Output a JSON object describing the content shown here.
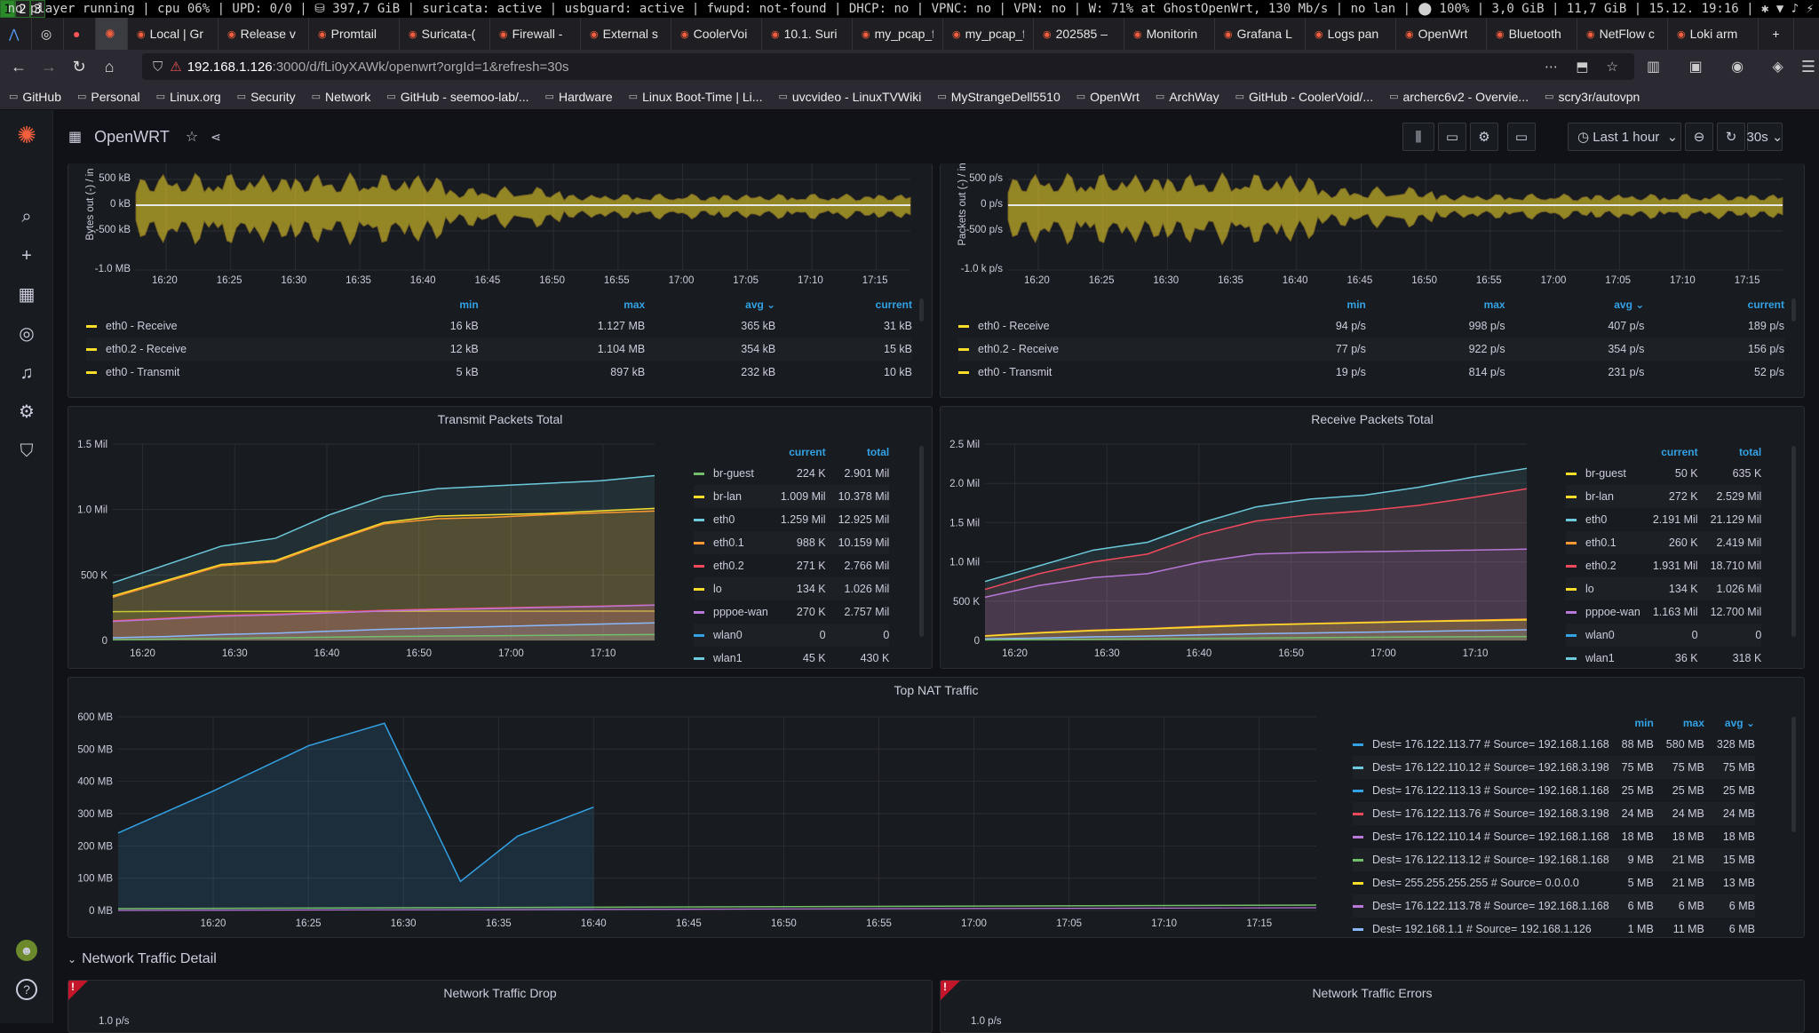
{
  "statusbar": {
    "workspaces": [
      "1",
      "2",
      "3"
    ],
    "text": "no player running | cpu  06% | UPD: 0/0 | ⛁ 397,7 GiB | suricata: active | usbguard: active | fwupd: not-found | DHCP: no | VPNC: no | VPN: no | W:  71% at GhostOpenWrt, 130 Mb/s | no lan | ⬤ 100% | 3,0 GiB | 11,7 GiB | 15.12. 19:16 | ✱ ▼ ♪ ⚡"
  },
  "tabs": [
    "Local | Gr",
    "Release v",
    "Promtail",
    "Suricata-(",
    "Firewall -",
    "External s",
    "CoolerVoi",
    "10.1. Suri",
    "my_pcap_file",
    "my_pcap_file",
    "202585 –",
    "Monitorin",
    "Grafana L",
    "Logs pan",
    "OpenWrt",
    "Bluetooth",
    "NetFlow c",
    "Loki arm"
  ],
  "url": {
    "host": "192.168.1.126",
    "path": ":3000/d/fLi0yXAWk/openwrt?orgId=1&refresh=30s"
  },
  "bookmarks": [
    "GitHub",
    "Personal",
    "Linux.org",
    "Security",
    "Network",
    "GitHub - seemoo-lab/...",
    "Hardware",
    "Linux Boot-Time | Li...",
    "uvcvideo - LinuxTVWiki",
    "MyStrangeDell5510",
    "OpenWrt",
    "ArchWay",
    "GitHub - CoolerVoid/...",
    "archerc6v2 - Overvie...",
    "scry3r/autovpn"
  ],
  "dashboard": {
    "title": "OpenWRT",
    "time_range": "Last 1 hour",
    "refresh": "30s"
  },
  "top_left": {
    "ylabel": "Bytes out (-) / in",
    "yticks": [
      "500 kB",
      "0 kB",
      "-500 kB",
      "-1.0 MB"
    ],
    "xticks": [
      "16:20",
      "16:25",
      "16:30",
      "16:35",
      "16:40",
      "16:45",
      "16:50",
      "16:55",
      "17:00",
      "17:05",
      "17:10",
      "17:15"
    ],
    "cols": [
      "min",
      "max",
      "avg ⌄",
      "current"
    ],
    "rows": [
      [
        "eth0 - Receive",
        "16 kB",
        "1.127 MB",
        "365 kB",
        "31 kB"
      ],
      [
        "eth0.2 - Receive",
        "12 kB",
        "1.104 MB",
        "354 kB",
        "15 kB"
      ],
      [
        "eth0 - Transmit",
        "5 kB",
        "897 kB",
        "232 kB",
        "10 kB"
      ]
    ]
  },
  "top_right": {
    "ylabel": "Packets out (-) / in",
    "yticks": [
      "500 p/s",
      "0 p/s",
      "-500 p/s",
      "-1.0 k p/s"
    ],
    "xticks": [
      "16:20",
      "16:25",
      "16:30",
      "16:35",
      "16:40",
      "16:45",
      "16:50",
      "16:55",
      "17:00",
      "17:05",
      "17:10",
      "17:15"
    ],
    "cols": [
      "min",
      "max",
      "avg ⌄",
      "current"
    ],
    "rows": [
      [
        "eth0 - Receive",
        "94 p/s",
        "998 p/s",
        "407 p/s",
        "189 p/s"
      ],
      [
        "eth0.2 - Receive",
        "77 p/s",
        "922 p/s",
        "354 p/s",
        "156 p/s"
      ],
      [
        "eth0 - Transmit",
        "19 p/s",
        "814 p/s",
        "231 p/s",
        "52 p/s"
      ]
    ]
  },
  "tx_panel": {
    "title": "Transmit Packets Total",
    "cols": [
      "current",
      "total"
    ],
    "rows": [
      [
        "br-guest",
        "224 K",
        "2.901 Mil"
      ],
      [
        "br-lan",
        "1.009 Mil",
        "10.378 Mil"
      ],
      [
        "eth0",
        "1.259 Mil",
        "12.925 Mil"
      ],
      [
        "eth0.1",
        "988 K",
        "10.159 Mil"
      ],
      [
        "eth0.2",
        "271 K",
        "2.766 Mil"
      ],
      [
        "lo",
        "134 K",
        "1.026 Mil"
      ],
      [
        "pppoe-wan",
        "270 K",
        "2.757 Mil"
      ],
      [
        "wlan0",
        "0",
        "0"
      ],
      [
        "wlan1",
        "45 K",
        "430 K"
      ]
    ]
  },
  "rx_panel": {
    "title": "Receive Packets Total",
    "cols": [
      "current",
      "total"
    ],
    "rows": [
      [
        "br-guest",
        "50 K",
        "635 K"
      ],
      [
        "br-lan",
        "272 K",
        "2.529 Mil"
      ],
      [
        "eth0",
        "2.191 Mil",
        "21.129 Mil"
      ],
      [
        "eth0.1",
        "260 K",
        "2.419 Mil"
      ],
      [
        "eth0.2",
        "1.931 Mil",
        "18.710 Mil"
      ],
      [
        "lo",
        "134 K",
        "1.026 Mil"
      ],
      [
        "pppoe-wan",
        "1.163 Mil",
        "12.700 Mil"
      ],
      [
        "wlan0",
        "0",
        "0"
      ],
      [
        "wlan1",
        "36 K",
        "318 K"
      ]
    ]
  },
  "nat_panel": {
    "title": "Top NAT Traffic",
    "cols": [
      "min",
      "max",
      "avg ⌄"
    ],
    "rows": [
      [
        "Dest= 176.122.113.77 # Source= 192.168.1.168",
        "88 MB",
        "580 MB",
        "328 MB"
      ],
      [
        "Dest= 176.122.110.12 # Source= 192.168.3.198",
        "75 MB",
        "75 MB",
        "75 MB"
      ],
      [
        "Dest= 176.122.113.13 # Source= 192.168.1.168",
        "25 MB",
        "25 MB",
        "25 MB"
      ],
      [
        "Dest= 176.122.113.76 # Source= 192.168.3.198",
        "24 MB",
        "24 MB",
        "24 MB"
      ],
      [
        "Dest= 176.122.110.14 # Source= 192.168.1.168",
        "18 MB",
        "18 MB",
        "18 MB"
      ],
      [
        "Dest= 176.122.113.12 # Source= 192.168.1.168",
        "9 MB",
        "21 MB",
        "15 MB"
      ],
      [
        "Dest= 255.255.255.255 # Source= 0.0.0.0",
        "5 MB",
        "21 MB",
        "13 MB"
      ],
      [
        "Dest= 176.122.113.78 # Source= 192.168.1.168",
        "6 MB",
        "6 MB",
        "6 MB"
      ],
      [
        "Dest= 192.168.1.1 # Source= 192.168.1.126",
        "1 MB",
        "11 MB",
        "6 MB"
      ]
    ]
  },
  "section": {
    "title": "Network Traffic Detail"
  },
  "drop_panel": {
    "title": "Network Traffic Drop",
    "ytick": "1.0 p/s"
  },
  "err_panel": {
    "title": "Network Traffic Errors",
    "ytick": "1.0 p/s"
  },
  "colors": {
    "blue": "#33a2e5",
    "green": "#73bf69",
    "yellow": "#fade2a",
    "orange": "#ff9830",
    "red": "#f2495c",
    "purple": "#b877d9",
    "cyan": "#8ab8ff",
    "teal": "#6ccadc",
    "accent": "#f55f3e"
  },
  "chart_data": [
    {
      "type": "area",
      "title": "Transmit Packets Total",
      "xlabel": "",
      "ylabel": "",
      "x": [
        "16:15",
        "16:20",
        "16:25",
        "16:30",
        "16:35",
        "16:40",
        "16:45",
        "16:50",
        "17:00",
        "17:10",
        "17:15"
      ],
      "ylim": [
        0,
        1500000
      ],
      "series": [
        {
          "name": "eth0",
          "color": "#6ccadc",
          "values": [
            440000,
            580000,
            720000,
            780000,
            960000,
            1100000,
            1160000,
            1180000,
            1200000,
            1220000,
            1259000
          ]
        },
        {
          "name": "br-lan",
          "color": "#fade2a",
          "values": [
            340000,
            460000,
            580000,
            610000,
            760000,
            900000,
            950000,
            960000,
            970000,
            990000,
            1009000
          ]
        },
        {
          "name": "eth0.1",
          "color": "#ff9830",
          "values": [
            330000,
            450000,
            570000,
            600000,
            750000,
            890000,
            930000,
            940000,
            960000,
            975000,
            988000
          ]
        },
        {
          "name": "br-guest",
          "color": "#c8c832",
          "values": [
            220000,
            222000,
            222000,
            222000,
            222000,
            222000,
            223000,
            223000,
            223000,
            224000,
            224000
          ]
        },
        {
          "name": "eth0.2",
          "color": "#f2495c",
          "values": [
            150000,
            170000,
            190000,
            200000,
            215000,
            230000,
            240000,
            248000,
            255000,
            262000,
            271000
          ]
        },
        {
          "name": "pppoe-wan",
          "color": "#b877d9",
          "values": [
            145000,
            165000,
            185000,
            195000,
            210000,
            225000,
            235000,
            243000,
            252000,
            260000,
            270000
          ]
        },
        {
          "name": "lo",
          "color": "#8ab8ff",
          "values": [
            20000,
            30000,
            45000,
            55000,
            70000,
            85000,
            95000,
            105000,
            115000,
            125000,
            134000
          ]
        },
        {
          "name": "wlan1",
          "color": "#73bf69",
          "values": [
            5000,
            10000,
            15000,
            20000,
            25000,
            30000,
            33000,
            36000,
            39000,
            42000,
            45000
          ]
        }
      ]
    },
    {
      "type": "area",
      "title": "Receive Packets Total",
      "xlabel": "",
      "ylabel": "",
      "x": [
        "16:15",
        "16:20",
        "16:25",
        "16:30",
        "16:35",
        "16:40",
        "16:45",
        "16:50",
        "17:00",
        "17:10",
        "17:15"
      ],
      "ylim": [
        0,
        2500000
      ],
      "series": [
        {
          "name": "eth0",
          "color": "#6ccadc",
          "values": [
            750000,
            950000,
            1150000,
            1250000,
            1500000,
            1700000,
            1800000,
            1850000,
            1950000,
            2080000,
            2191000
          ]
        },
        {
          "name": "eth0.2",
          "color": "#f2495c",
          "values": [
            650000,
            850000,
            1000000,
            1100000,
            1350000,
            1520000,
            1600000,
            1650000,
            1720000,
            1820000,
            1931000
          ]
        },
        {
          "name": "pppoe-wan",
          "color": "#b877d9",
          "values": [
            550000,
            700000,
            800000,
            850000,
            1000000,
            1100000,
            1120000,
            1130000,
            1140000,
            1150000,
            1163000
          ]
        },
        {
          "name": "br-lan",
          "color": "#ff9830",
          "values": [
            60000,
            100000,
            130000,
            150000,
            180000,
            200000,
            215000,
            230000,
            245000,
            258000,
            272000
          ]
        },
        {
          "name": "eth0.1",
          "color": "#fade2a",
          "values": [
            55000,
            95000,
            125000,
            145000,
            170000,
            195000,
            210000,
            225000,
            240000,
            250000,
            260000
          ]
        },
        {
          "name": "lo",
          "color": "#8ab8ff",
          "values": [
            20000,
            30000,
            45000,
            55000,
            70000,
            85000,
            95000,
            105000,
            115000,
            125000,
            134000
          ]
        },
        {
          "name": "br-guest",
          "color": "#73bf69",
          "values": [
            5000,
            10000,
            15000,
            20000,
            25000,
            30000,
            35000,
            40000,
            44000,
            47000,
            50000
          ]
        }
      ]
    },
    {
      "type": "area",
      "title": "Top NAT Traffic",
      "xlabel": "",
      "ylabel": "",
      "x": [
        "16:15",
        "16:20",
        "16:25",
        "16:29",
        "16:33",
        "16:36",
        "16:40"
      ],
      "ylim": [
        0,
        600
      ],
      "series": [
        {
          "name": "Dest= 176.122.113.77 # Source= 192.168.1.168",
          "color": "#33a2e5",
          "values": [
            240,
            370,
            510,
            580,
            90,
            230,
            320
          ]
        }
      ]
    }
  ]
}
